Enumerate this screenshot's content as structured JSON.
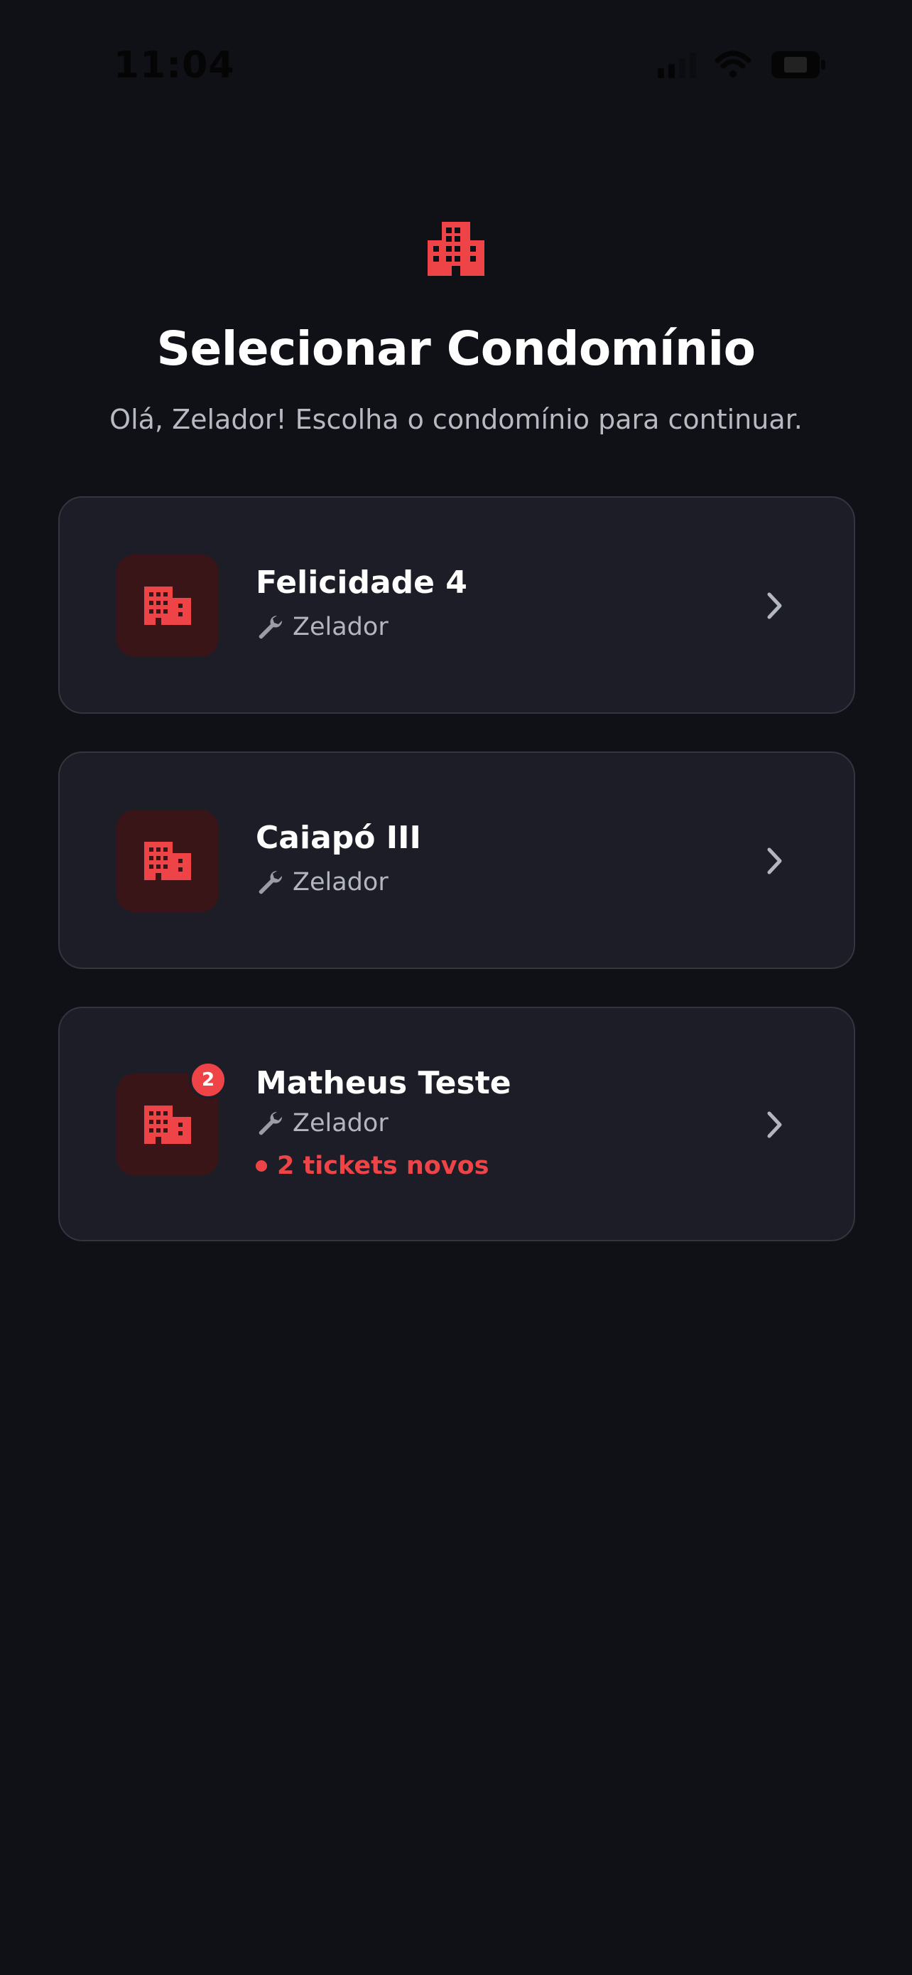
{
  "status_bar": {
    "time": "11:04",
    "icons": [
      "signal-icon",
      "wifi-icon",
      "battery-icon"
    ]
  },
  "header": {
    "icon": "building-icon",
    "title": "Selecionar Condomínio",
    "subtitle": "Olá, Zelador! Escolha o condomínio para continuar."
  },
  "condominiums": [
    {
      "name": "Felicidade 4",
      "role_icon": "wrench-icon",
      "role": "Zelador"
    },
    {
      "name": "Caiapó III",
      "role_icon": "wrench-icon",
      "role": "Zelador"
    },
    {
      "name": "Matheus Teste",
      "role_icon": "wrench-icon",
      "role": "Zelador",
      "badge_count": "2",
      "tickets_text": "2 tickets novos"
    }
  ],
  "colors": {
    "background": "#101116",
    "card": "#1c1d26",
    "card_border": "#33353f",
    "accent": "#ef4447",
    "icon_box": "#3a1517",
    "muted_text": "#b3b5bf"
  }
}
